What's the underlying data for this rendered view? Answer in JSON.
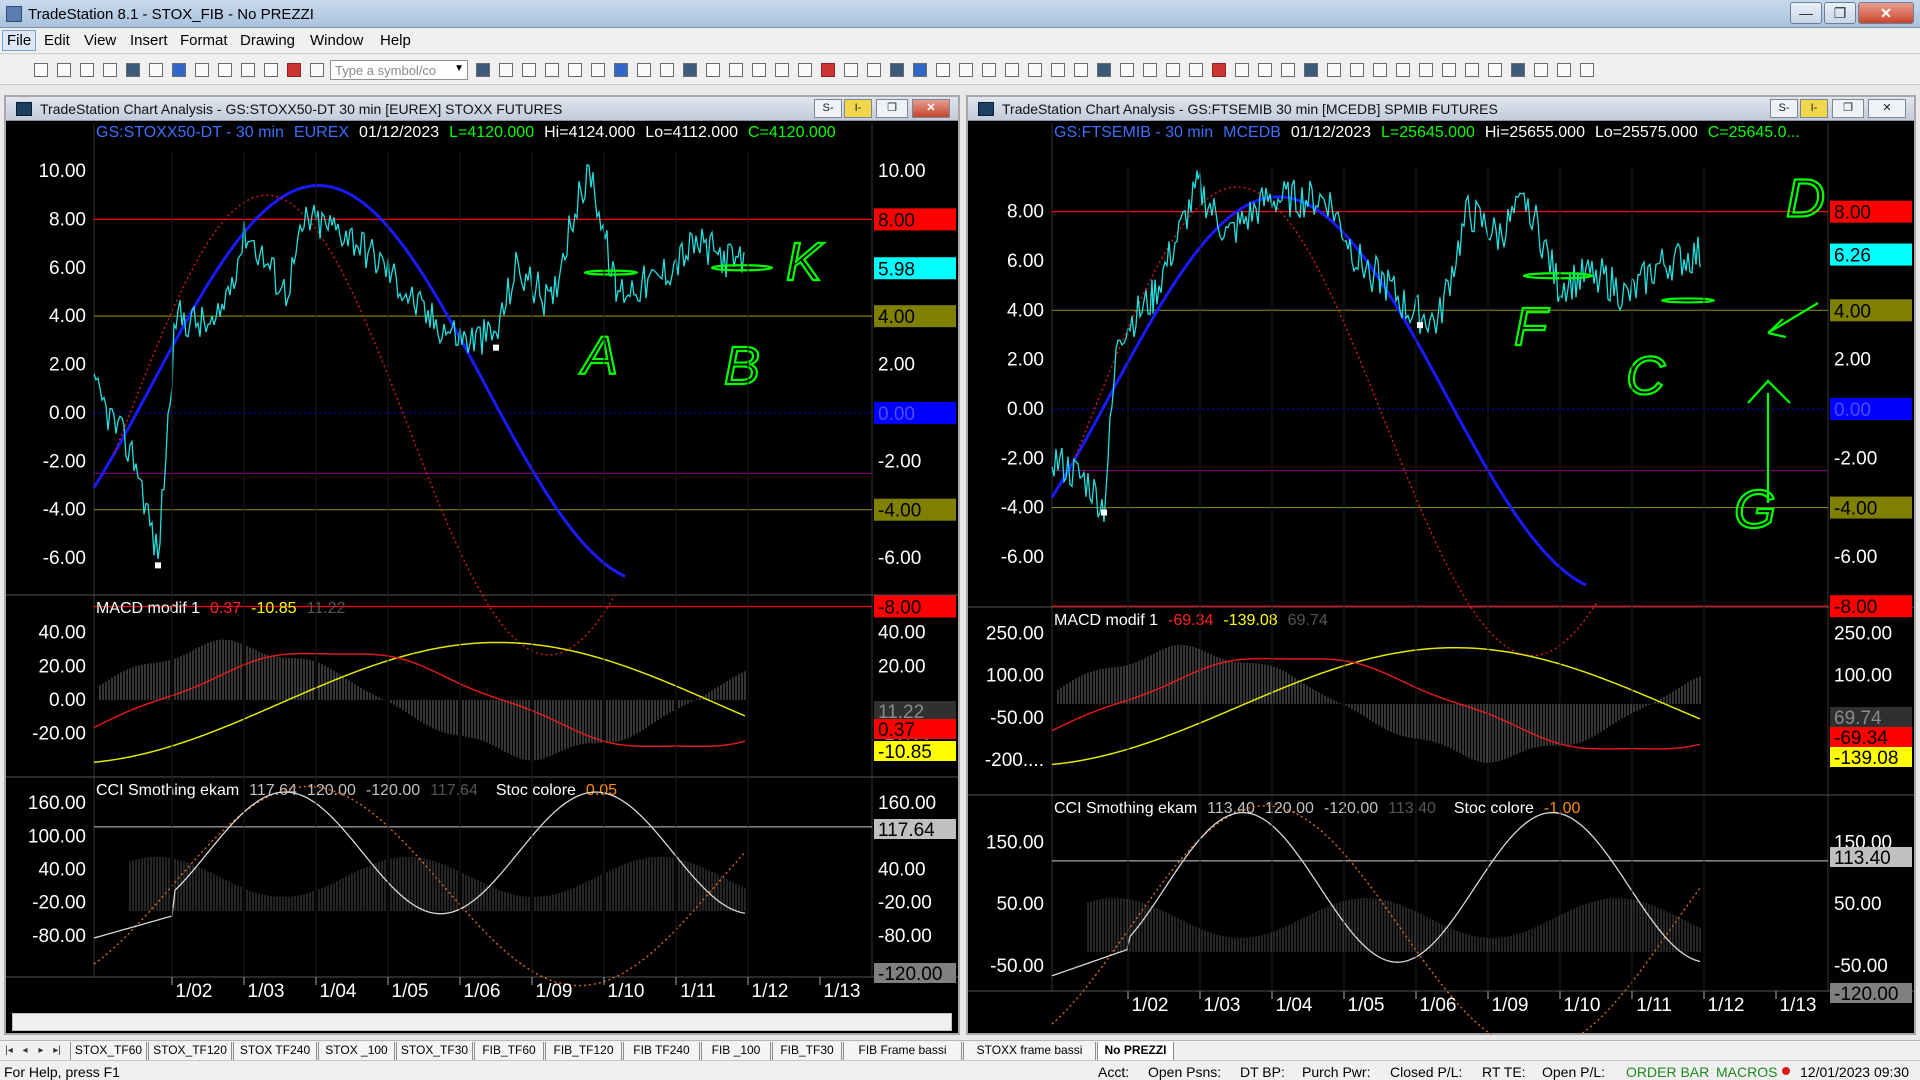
{
  "window": {
    "title": "TradeStation 8.1 - STOX_FIB - No PREZZI",
    "minimize": "—",
    "maximize": "❐",
    "close": "✕"
  },
  "menu": [
    "File",
    "Edit",
    "View",
    "Insert",
    "Format",
    "Drawing",
    "Window",
    "Help"
  ],
  "toolbar": {
    "symbol_placeholder": "Type a symbol/co"
  },
  "charts": [
    {
      "window_title": "TradeStation Chart Analysis - GS:STOXX50-DT  30 min  [EUREX] STOXX FUTURES",
      "header": {
        "symbol": "GS:STOXX50-DT - 30 min",
        "exchange": "EUREX",
        "date": "01/12/2023",
        "last": "L=4120.000",
        "high": "Hi=4124.000",
        "low": "Lo=4112.000",
        "close": "C=4120.000"
      },
      "price_ticks": [
        "10.00",
        "8.00",
        "6.00",
        "4.00",
        "2.00",
        "0.00",
        "-2.00",
        "-4.00",
        "-6.00"
      ],
      "price_right_ticks": [
        "10.00",
        "2.00",
        "-2.00",
        "-6.00"
      ],
      "price_badges": [
        {
          "text": "8.00",
          "bg": "#ff0000",
          "fg": "#000000"
        },
        {
          "text": "5.98",
          "bg": "#00ffff",
          "fg": "#000000"
        },
        {
          "text": "4.00",
          "bg": "#808000",
          "fg": "#000000"
        },
        {
          "text": "0.00",
          "bg": "#0000ff",
          "fg": "#4d4dff"
        },
        {
          "text": "-4.00",
          "bg": "#808000",
          "fg": "#000000"
        },
        {
          "text": "-8.00",
          "bg": "#ff0000",
          "fg": "#000000"
        }
      ],
      "macd": {
        "label": "MACD modif 1",
        "v1": "0.37",
        "v2": "-10.85",
        "v3": "11.22",
        "ticks": [
          "40.00",
          "20.00",
          "0.00",
          "-20.00"
        ],
        "right_ticks": [
          "40.00",
          "20.00",
          "-20.00"
        ],
        "badges": [
          {
            "text": "11.22",
            "bg": "#303030",
            "fg": "#8a8a8a"
          },
          {
            "text": "0.37",
            "bg": "#ff0000",
            "fg": "#000000"
          },
          {
            "text": "-10.85",
            "bg": "#ffff00",
            "fg": "#000000"
          }
        ]
      },
      "cci": {
        "label": "CCI Smothing ekam",
        "v1": "117.64",
        "v2": "120.00",
        "v3": "-120.00",
        "v4": "117.64",
        "stoc_label": "Stoc colore",
        "stoc_val": "0.05",
        "ticks": [
          "160.00",
          "100.00",
          "40.00",
          "-20.00",
          "-80.00"
        ],
        "right_ticks": [
          "160.00",
          "40.00",
          "-20.00",
          "-80.00"
        ],
        "badges": [
          {
            "text": "117.64",
            "bg": "#c0c0c0",
            "fg": "#000000"
          },
          {
            "text": "-120.00",
            "bg": "#808080",
            "fg": "#000000"
          }
        ]
      },
      "dates": [
        "1/02",
        "1/03",
        "1/04",
        "1/05",
        "1/06",
        "1/09",
        "1/10",
        "1/11",
        "1/12",
        "1/13"
      ],
      "annotations": [
        "A",
        "B",
        "K"
      ]
    },
    {
      "window_title": "TradeStation Chart Analysis - GS:FTSEMIB  30 min  [MCEDB] SPMIB FUTURES",
      "header": {
        "symbol": "GS:FTSEMIB - 30 min",
        "exchange": "MCEDB",
        "date": "01/12/2023",
        "last": "L=25645.000",
        "high": "Hi=25655.000",
        "low": "Lo=25575.000",
        "close": "C=25645.0..."
      },
      "price_ticks": [
        "8.00",
        "6.00",
        "4.00",
        "2.00",
        "0.00",
        "-2.00",
        "-4.00",
        "-6.00"
      ],
      "price_right_ticks": [
        "2.00",
        "-2.00",
        "-6.00"
      ],
      "price_badges": [
        {
          "text": "8.00",
          "bg": "#ff0000",
          "fg": "#000000"
        },
        {
          "text": "6.26",
          "bg": "#00ffff",
          "fg": "#000000"
        },
        {
          "text": "4.00",
          "bg": "#808000",
          "fg": "#000000"
        },
        {
          "text": "0.00",
          "bg": "#0000ff",
          "fg": "#4d4dff"
        },
        {
          "text": "-4.00",
          "bg": "#808000",
          "fg": "#000000"
        },
        {
          "text": "-8.00",
          "bg": "#ff0000",
          "fg": "#000000"
        }
      ],
      "macd": {
        "label": "MACD modif 1",
        "v1": "-69.34",
        "v2": "-139.08",
        "v3": "69.74",
        "ticks": [
          "250.00",
          "100.00",
          "-50.00",
          "-200...."
        ],
        "right_ticks": [
          "250.00",
          "100.00",
          "-200.00"
        ],
        "badges": [
          {
            "text": "69.74",
            "bg": "#303030",
            "fg": "#8a8a8a"
          },
          {
            "text": "-69.34",
            "bg": "#ff0000",
            "fg": "#000000"
          },
          {
            "text": "-139.08",
            "bg": "#ffff00",
            "fg": "#000000"
          }
        ]
      },
      "cci": {
        "label": "CCI Smothing ekam",
        "v1": "113.40",
        "v2": "120.00",
        "v3": "-120.00",
        "v4": "113.40",
        "stoc_label": "Stoc colore",
        "stoc_val": "-1.00",
        "ticks": [
          "150.00",
          "50.00",
          "-50.00"
        ],
        "right_ticks": [
          "150.00",
          "50.00",
          "-50.00"
        ],
        "badges": [
          {
            "text": "113.40",
            "bg": "#c0c0c0",
            "fg": "#000000"
          },
          {
            "text": "-120.00",
            "bg": "#808080",
            "fg": "#000000"
          }
        ]
      },
      "dates": [
        "1/02",
        "1/03",
        "1/04",
        "1/05",
        "1/06",
        "1/09",
        "1/10",
        "1/11",
        "1/12",
        "1/13"
      ],
      "annotations": [
        "F",
        "C",
        "D",
        "G"
      ]
    }
  ],
  "tabs": [
    "STOX_TF60",
    "STOX_TF120",
    "STOX TF240",
    "STOX _100",
    "STOX_TF30",
    "FIB_TF60",
    "FIB_TF120",
    "FIB TF240",
    "FIB _100",
    "FIB_TF30",
    "FIB Frame bassi",
    "STOXX frame bassi",
    "No PREZZI"
  ],
  "status": {
    "help": "For Help, press F1",
    "acct": "Acct:",
    "open_psns": "Open Psns:",
    "dt_bp": "DT BP:",
    "purch_pwr": "Purch Pwr:",
    "closed_pl": "Closed P/L:",
    "rt_te": "RT TE:",
    "open_pl": "Open P/L:",
    "order_bar": "ORDER BAR",
    "macros": "MACROS",
    "datetime": "12/01/2023 09:30"
  },
  "colors": {
    "price": "#00ffff",
    "blue_wave": "#0000ff",
    "red_cycle": "#ff0000",
    "trend_magenta": "#ff00ff",
    "annotations": "#00ff00",
    "macd_yellow": "#ffff00"
  }
}
